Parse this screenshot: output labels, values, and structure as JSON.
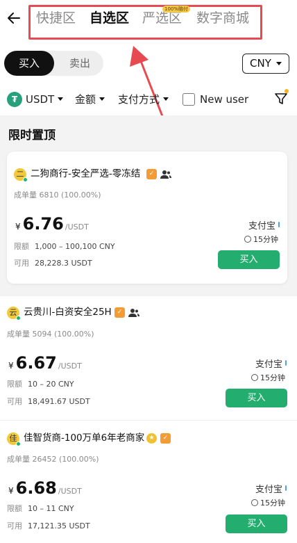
{
  "header": {
    "tabs": [
      {
        "label": "快捷区"
      },
      {
        "label": "自选区"
      },
      {
        "label": "严选区"
      },
      {
        "label": "数字商城"
      }
    ],
    "badge": "100%赔付"
  },
  "trade": {
    "buy_label": "买入",
    "sell_label": "卖出"
  },
  "currency": {
    "value": "CNY"
  },
  "filters": {
    "coin": "USDT",
    "coin_glyph": "₮",
    "amount": "金额",
    "payment": "支付方式",
    "new_user": "New user"
  },
  "section": {
    "title": "限时置顶"
  },
  "labels": {
    "deals": "成单量",
    "limit": "限额",
    "available": "可用",
    "currency_symbol": "¥",
    "unit": "/USDT",
    "buy": "买入"
  },
  "listings": [
    {
      "avatar": "二",
      "name": "二狗商行-安全严选-零冻结",
      "deals": "6810",
      "rate": "(100.00%)",
      "price": "6.76",
      "limit": "1,000 – 100,100 CNY",
      "available": "28,228.3 USDT",
      "payment": "支付宝",
      "time": "15分钟"
    },
    {
      "avatar": "云",
      "name": "云贵川-白资安全25H",
      "deals": "5094",
      "rate": "(100.00%)",
      "price": "6.67",
      "limit": "10 – 20 CNY",
      "available": "18,491.67 USDT",
      "payment": "支付宝",
      "time": "15分钟"
    },
    {
      "avatar": "佳",
      "name": "佳智货商-100万单6年老商家",
      "deals": "26452",
      "rate": "(100.00%)",
      "price": "6.68",
      "limit": "10 – 11 CNY",
      "available": "17,121.35 USDT",
      "payment": "支付宝",
      "time": "15分钟"
    }
  ],
  "colors": {
    "accent_green": "#23ad6f",
    "annotation_red": "#e84a52"
  }
}
